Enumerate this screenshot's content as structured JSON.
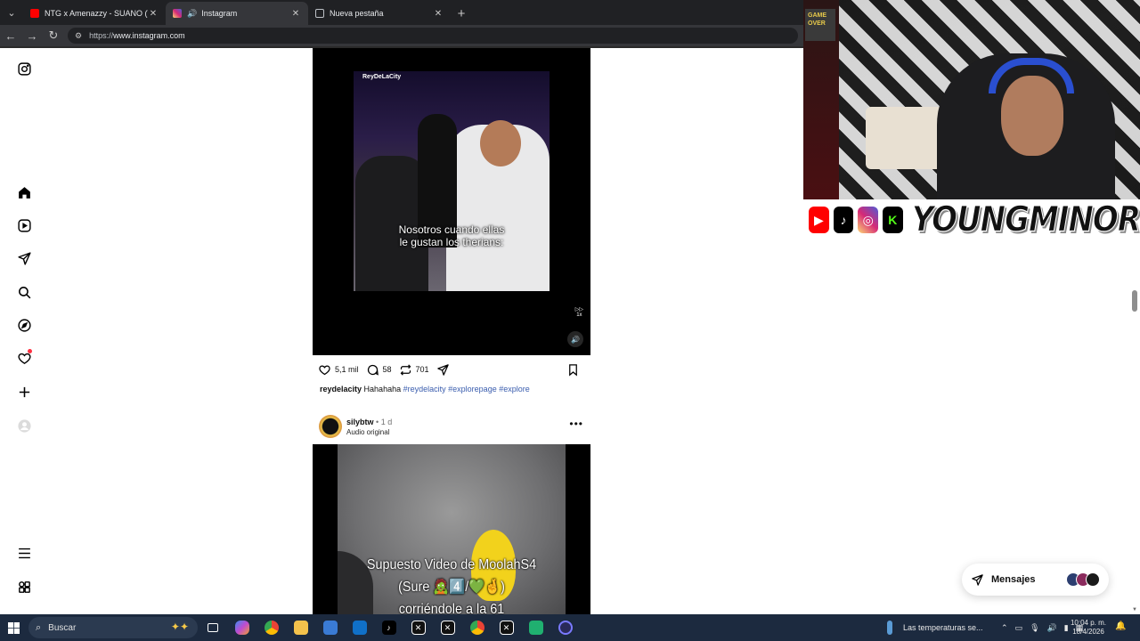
{
  "browser": {
    "tabs": [
      {
        "label": "NTG x Amenazzy - SUANO (Video",
        "favicon_color": "#ff0000",
        "active": false
      },
      {
        "label": "Instagram",
        "favicon_color": "#d62976",
        "active": true
      },
      {
        "label": "Nueva pestaña",
        "favicon_color": "#bdc1c6",
        "active": false
      }
    ],
    "url_scheme": "https://",
    "url_host": "www.instagram.com"
  },
  "post1": {
    "video_handle": "ReyDeLaCity",
    "video_caption_line1": "Nosotros cuando ellas",
    "video_caption_line2": "le gustan los therians:",
    "speed_label": "1x",
    "likes": "5,1 mil",
    "comments": "58",
    "reposts": "701",
    "caption_user": "reydelacity",
    "caption_text": "Hahahaha",
    "hashtags": [
      "#reydelacity",
      "#explorepage",
      "#explore"
    ]
  },
  "post2": {
    "username": "silybtw",
    "separator": "•",
    "time": "1 d",
    "audio": "Audio original",
    "more": "•••",
    "video_caption_line1": "Supuesto Video de MoolahS4",
    "video_caption_line2": "(Sure 🧟4️⃣/💚🤞)",
    "video_caption_line3": "corriéndole a la 61"
  },
  "messages": {
    "label": "Mensajes"
  },
  "overlay": {
    "brand_text": "YOUNGMINOR",
    "poster_text": "GAME OVER"
  },
  "taskbar": {
    "search_placeholder": "Buscar",
    "weather": "Las temperaturas se...",
    "time": "10:04 p. m.",
    "date": "18/4/2026"
  },
  "colors": {
    "accent_blue": "#3a5dae",
    "notification_red": "#ff3040"
  }
}
